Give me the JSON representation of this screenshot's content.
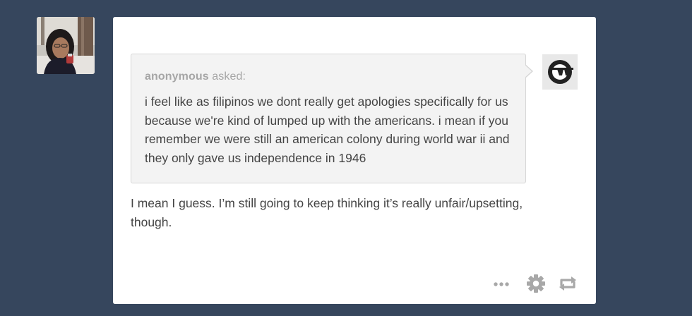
{
  "post": {
    "asker_name": "anonymous",
    "asked_label": "asked:",
    "question": "i feel like as filipinos we dont really get apologies specifically for us because we're kind of lumped up with the americans. i mean if you remember we were still an american colony during world war ii and they only gave us independence in 1946",
    "answer": "I mean I guess. I’m still going to keep thinking it’s really unfair/upsetting, though."
  },
  "icons": {
    "author_avatar": "author-avatar-photo",
    "asker_avatar": "anonymous-sunglasses-avatar",
    "more": "ellipsis-icon",
    "settings": "gear-icon",
    "reblog": "reblog-icon"
  },
  "colors": {
    "background": "#36465d",
    "card": "#ffffff",
    "question_bg": "#f3f3f3",
    "control_icons": "#a8a8a8"
  }
}
